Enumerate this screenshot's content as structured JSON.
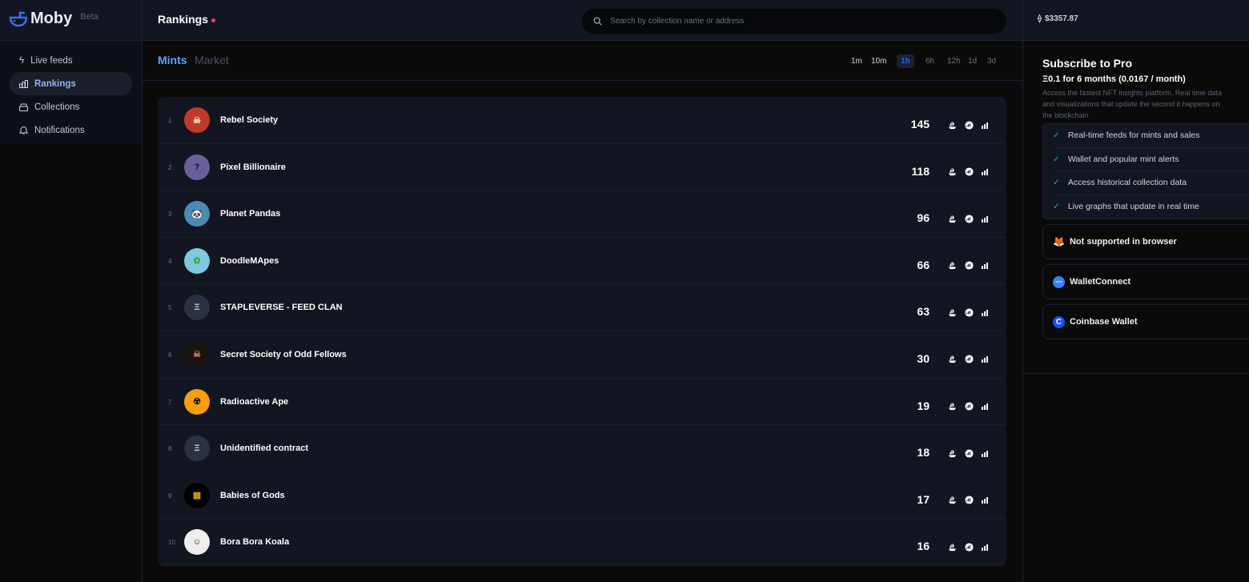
{
  "app": {
    "name": "Moby",
    "badge": "Beta"
  },
  "header": {
    "title": "Rankings",
    "search_placeholder": "Search by collection name or address",
    "eth_price": "$3357.87"
  },
  "sidebar": {
    "items": [
      {
        "label": "Live feeds",
        "icon": "sparkle-icon"
      },
      {
        "label": "Rankings",
        "icon": "bar-chart-icon",
        "active": true
      },
      {
        "label": "Collections",
        "icon": "stack-icon"
      },
      {
        "label": "Notifications",
        "icon": "bell-icon"
      }
    ]
  },
  "main": {
    "tabs": [
      {
        "label": "Mints",
        "active": true
      },
      {
        "label": "Market"
      }
    ],
    "timeframes": [
      "1m",
      "10m",
      "1h",
      "6h",
      "12h",
      "1d",
      "3d"
    ],
    "active_timeframe": "1h",
    "rows": [
      {
        "rank": "1",
        "name": "Rebel Society",
        "count": "145"
      },
      {
        "rank": "2",
        "name": "Pixel Billionaire",
        "count": "118"
      },
      {
        "rank": "3",
        "name": "Planet Pandas",
        "count": "96"
      },
      {
        "rank": "4",
        "name": "DoodleMApes",
        "count": "66"
      },
      {
        "rank": "5",
        "name": "STAPLEVERSE - FEED CLAN",
        "count": "63"
      },
      {
        "rank": "6",
        "name": "Secret Society of Odd Fellows",
        "count": "30"
      },
      {
        "rank": "7",
        "name": "Radioactive Ape",
        "count": "19"
      },
      {
        "rank": "8",
        "name": "Unidentified contract",
        "count": "18"
      },
      {
        "rank": "9",
        "name": "Babies of Gods",
        "count": "17"
      },
      {
        "rank": "10",
        "name": "Bora Bora Koala",
        "count": "16"
      }
    ]
  },
  "pro": {
    "title": "Subscribe to Pro",
    "price": "Ξ0.1 for 6 months (0.0167 / month)",
    "description": "Access the fastest NFT insights platform. Real time data and visualizations that update the second it happens on the blockchain",
    "features": [
      "Real-time feeds for mints and sales",
      "Wallet and popular mint alerts",
      "Access historical collection data",
      "Live graphs that update in real time"
    ],
    "wallets": [
      {
        "label": "Not supported in browser",
        "icon": "metamask-fox-icon"
      },
      {
        "label": "WalletConnect",
        "icon": "walletconnect-icon"
      },
      {
        "label": "Coinbase Wallet",
        "icon": "coinbase-icon"
      }
    ]
  },
  "colors": {
    "accent": "#60a5fa",
    "active_tf": "#2563eb",
    "check": "#10b981",
    "dot": "#f43f5e"
  }
}
